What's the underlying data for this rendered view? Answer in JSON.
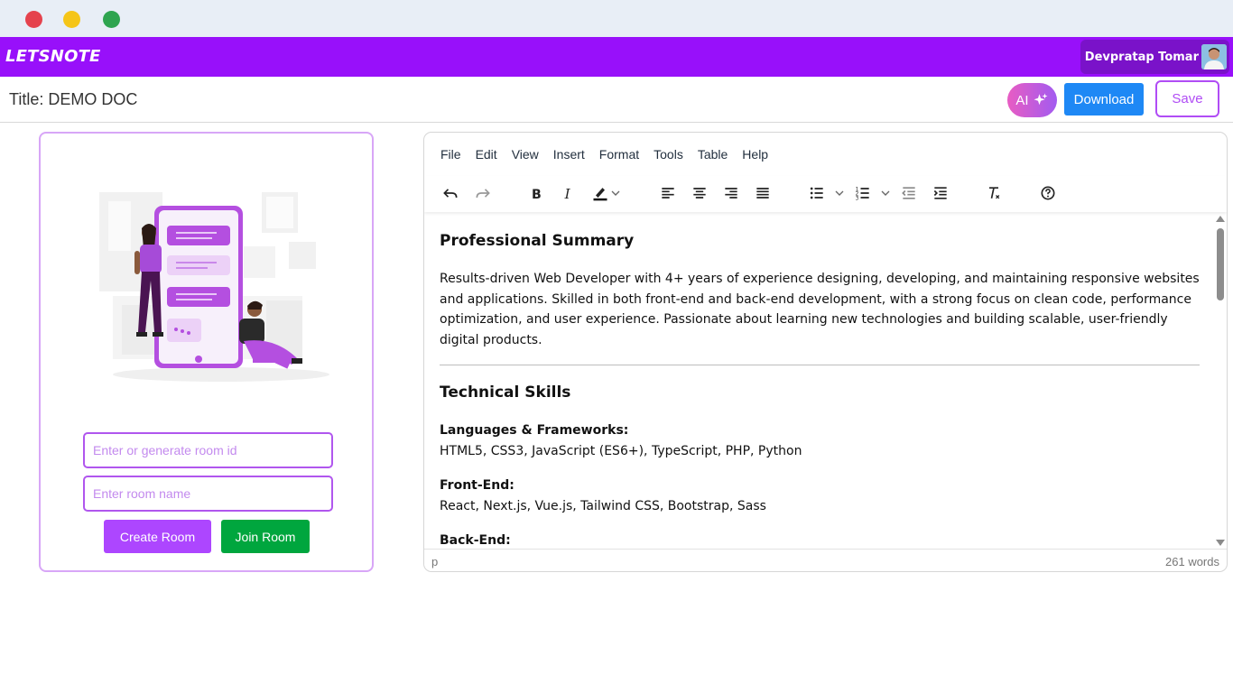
{
  "window": {
    "controls": [
      "close",
      "minimize",
      "maximize"
    ]
  },
  "navbar": {
    "logo": "LETSNOTE",
    "user_name": "Devpratap Tomar",
    "bg_color": "#9810fa"
  },
  "docbar": {
    "title": "Title: DEMO DOC",
    "ai_label": "AI",
    "download_label": "Download",
    "save_label": "Save"
  },
  "room": {
    "room_id_placeholder": "Enter or generate room id",
    "room_name_placeholder": "Enter room name",
    "create_label": "Create Room",
    "join_label": "Join Room"
  },
  "editor": {
    "menu": [
      "File",
      "Edit",
      "View",
      "Insert",
      "Format",
      "Tools",
      "Table",
      "Help"
    ],
    "toolbar_icons": [
      "undo-icon",
      "redo-icon",
      "bold-icon",
      "italic-icon",
      "highlight-icon",
      "align-left-icon",
      "align-center-icon",
      "align-right-icon",
      "align-justify-icon",
      "bullet-list-icon",
      "numbered-list-icon",
      "outdent-icon",
      "indent-icon",
      "clear-format-icon",
      "help-icon"
    ],
    "content": {
      "heading1": "Professional Summary",
      "summary": "Results-driven Web Developer with 4+ years of experience designing, developing, and maintaining responsive websites and applications. Skilled in both front-end and back-end development, with a strong focus on clean code, performance optimization, and user experience. Passionate about learning new technologies and building scalable, user-friendly digital products.",
      "heading2": "Technical Skills",
      "skills": [
        {
          "label": "Languages & Frameworks:",
          "value": "HTML5, CSS3, JavaScript (ES6+), TypeScript, PHP, Python"
        },
        {
          "label": "Front-End:",
          "value": "React, Next.js, Vue.js, Tailwind CSS, Bootstrap, Sass"
        },
        {
          "label": "Back-End:",
          "value": ""
        }
      ]
    },
    "status_path": "p",
    "word_count": "261 words"
  }
}
